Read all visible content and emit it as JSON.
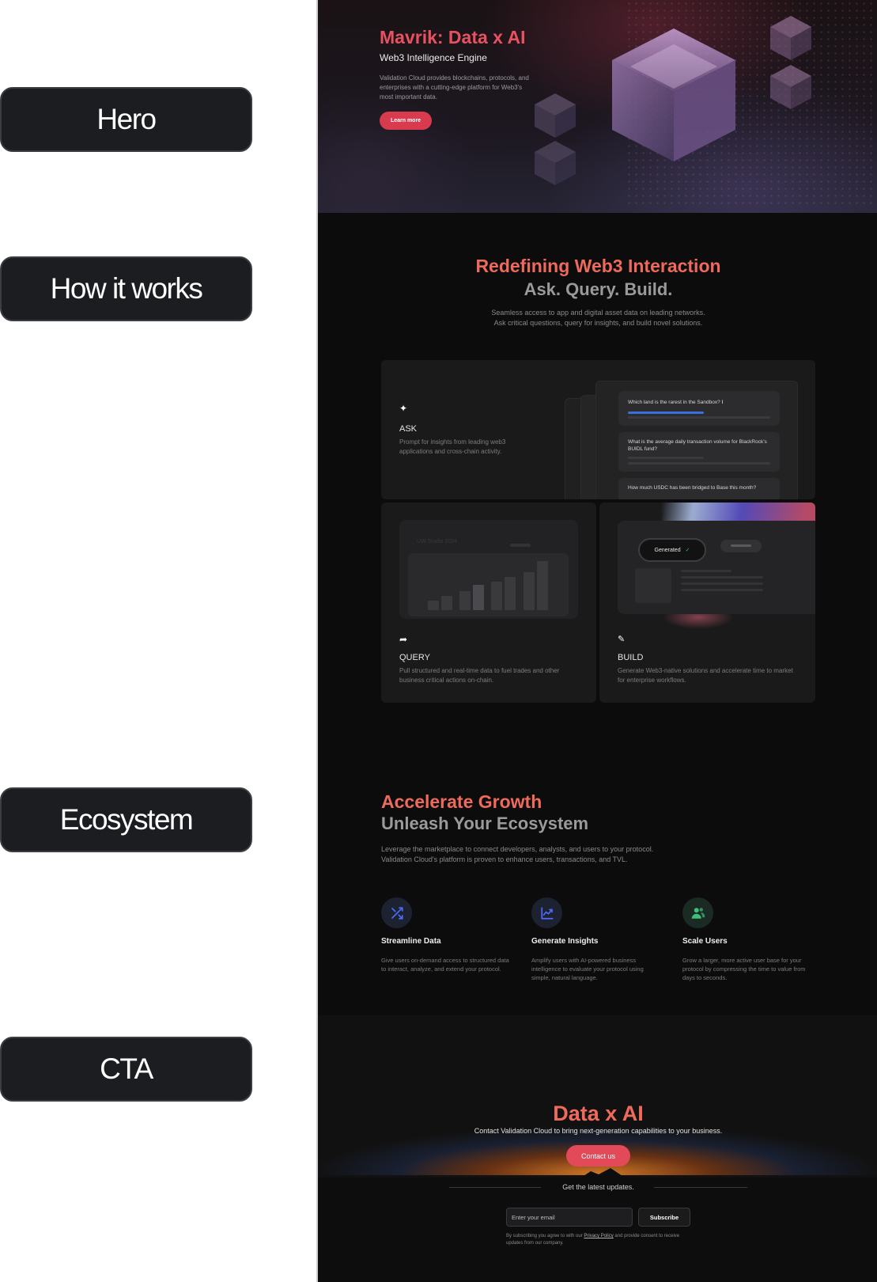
{
  "annotations": {
    "hero": "Hero",
    "how_it_works": "How it works",
    "ecosystem": "Ecosystem",
    "cta": "CTA"
  },
  "hero": {
    "title": "Mavrik: Data x AI",
    "subtitle": "Web3 Intelligence Engine",
    "description": "Validation Cloud provides blockchains, protocols, and enterprises with a cutting-edge platform for Web3's most important data.",
    "button_label": "Learn more"
  },
  "how": {
    "title": "Redefining Web3 Interaction",
    "title2": "Ask. Query. Build.",
    "desc_line1": "Seamless access to app and digital asset data on leading networks.",
    "desc_line2": "Ask critical questions, query for insights, and build novel solutions.",
    "ask": {
      "icon": "sparkle-icon",
      "title": "ASK",
      "description": "Prompt for insights from leading web3 applications and cross-chain activity.",
      "questions": [
        "Which land is the rarest in the Sandbox?",
        "What is the average daily transaction volume for BlackRock's BUIDL fund?",
        "How much USDC has been bridged to Base this month?"
      ]
    },
    "query": {
      "icon": "share-arrow-icon",
      "title": "QUERY",
      "description": "Pull structured and real-time data to fuel trades and other business critical actions on-chain.",
      "chart_label": "UW Studio 2024"
    },
    "build": {
      "icon": "edit-icon",
      "title": "BUILD",
      "description": "Generate Web3-native solutions and accelerate time to market for enterprise workflows.",
      "badge": "Generated"
    }
  },
  "eco": {
    "title": "Accelerate Growth",
    "title2": "Unleash Your Ecosystem",
    "desc_line1": "Leverage the marketplace to connect developers, analysts, and users to your protocol.",
    "desc_line2": "Validation Cloud's platform is proven to enhance users, transactions, and TVL.",
    "features": [
      {
        "icon": "shuffle-icon",
        "title": "Streamline Data",
        "description": "Give users on-demand access to structured data to interact, analyze, and extend your protocol."
      },
      {
        "icon": "chart-line-icon",
        "title": "Generate Insights",
        "description": "Amplify users with AI-powered business intelligence to evaluate your protocol using simple, natural language."
      },
      {
        "icon": "users-icon",
        "title": "Scale Users",
        "description": "Grow a larger, more active user base for your protocol by compressing the time to value from days to seconds."
      }
    ]
  },
  "cta": {
    "title": "Data x AI",
    "description": "Contact Validation Cloud to bring next-generation capabilities to your business.",
    "button_label": "Contact us",
    "updates_label": "Get the latest updates.",
    "email_placeholder": "Enter your email",
    "subscribe_label": "Subscribe",
    "legal_prefix": "By subscribing you agree to with our ",
    "legal_link": "Privacy Policy",
    "legal_suffix": " and provide consent to receive updates from our company."
  },
  "colors": {
    "accent_red": "#d83a4e",
    "accent_coral": "#ee6a5a",
    "icon_blue": "#4f6bff",
    "icon_green": "#3ec07a"
  }
}
